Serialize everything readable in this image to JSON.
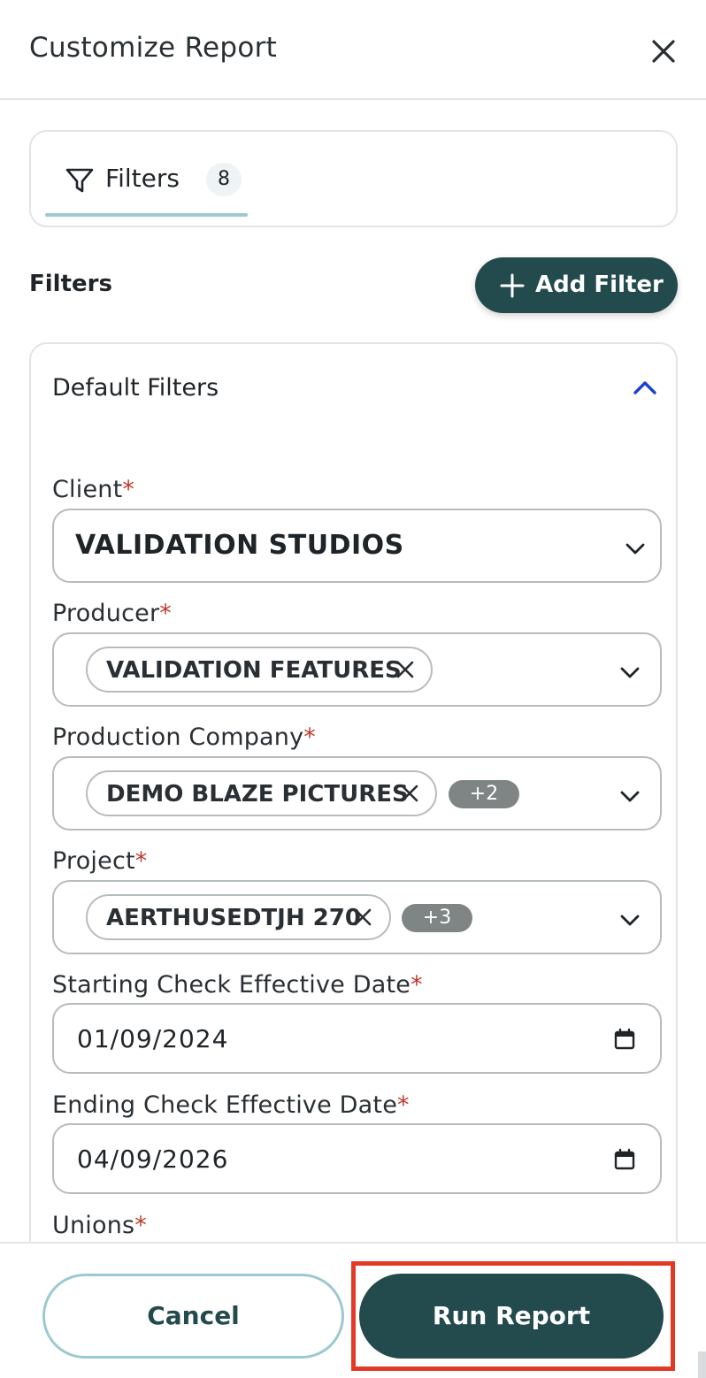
{
  "header": {
    "title": "Customize Report"
  },
  "tabs": [
    {
      "label": "Filters",
      "count": "8"
    }
  ],
  "filters": {
    "heading": "Filters",
    "add_label": "Add Filter"
  },
  "panel": {
    "title": "Default Filters",
    "required_mark": "*",
    "client": {
      "label": "Client",
      "value": "VALIDATION STUDIOS"
    },
    "producer": {
      "label": "Producer",
      "chip": "VALIDATION FEATURES"
    },
    "production_company": {
      "label": "Production Company",
      "chip": "DEMO BLAZE PICTURES",
      "more": "+2"
    },
    "project": {
      "label": "Project",
      "chip": "AERTHUSEDTJH 270",
      "more": "+3"
    },
    "start_date": {
      "label": "Starting Check Effective Date",
      "value": "01/09/2024"
    },
    "end_date": {
      "label": "Ending Check Effective Date",
      "value": "04/09/2026"
    },
    "unions": {
      "label": "Unions"
    }
  },
  "footer": {
    "cancel_label": "Cancel",
    "run_label": "Run Report"
  },
  "colors": {
    "primary": "#234b4e",
    "accent": "#9cc9cf",
    "required": "#c0392b",
    "highlight": "#e43a25",
    "collapse_icon": "#1a3fd6"
  }
}
